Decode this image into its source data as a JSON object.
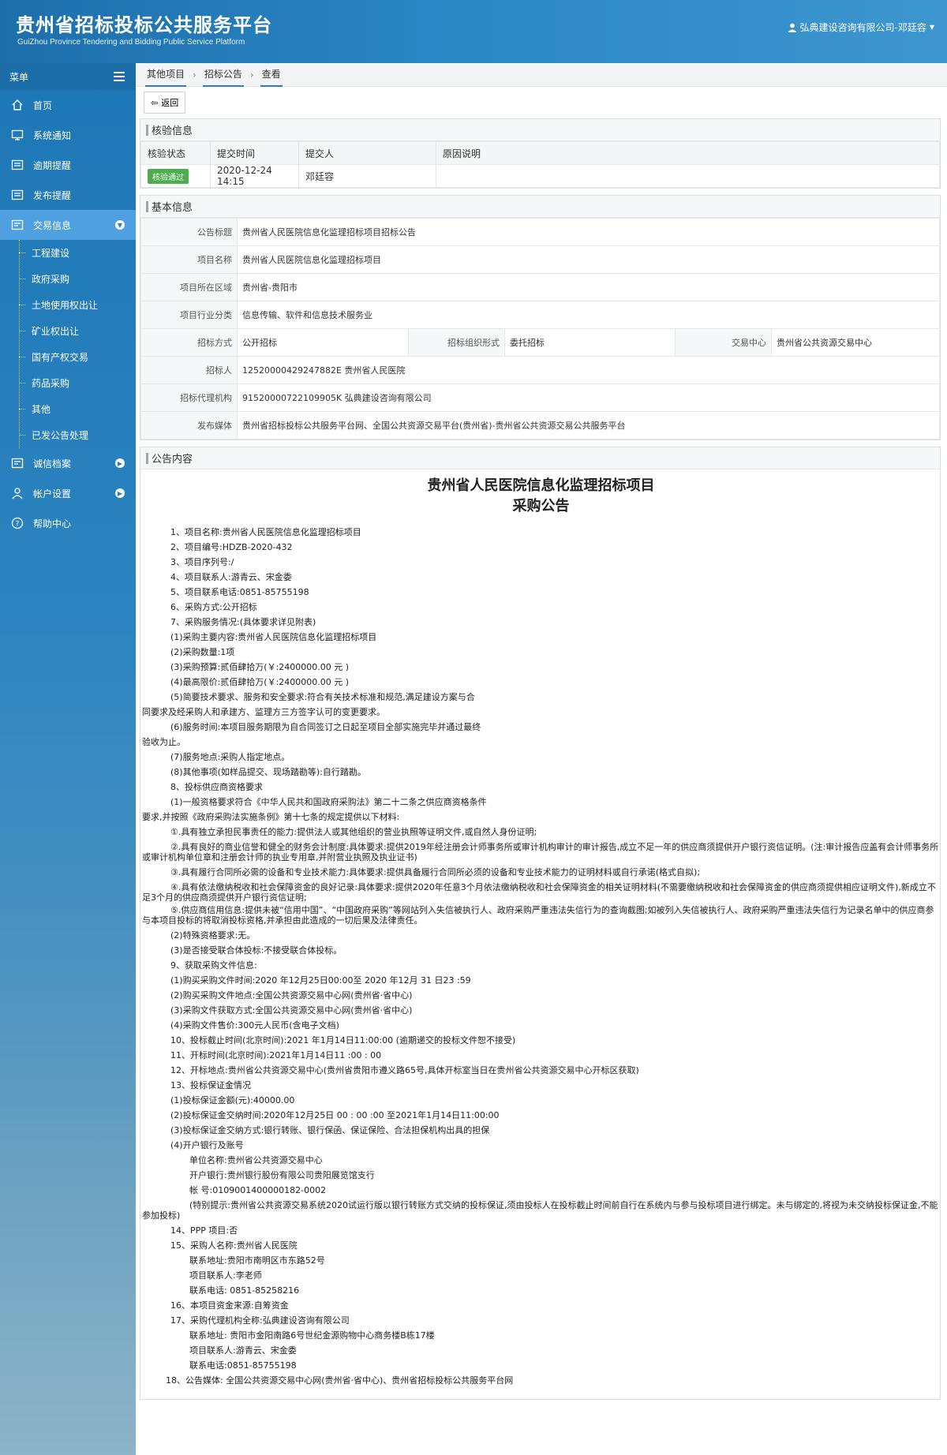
{
  "header": {
    "title": "贵州省招标投标公共服务平台",
    "subtitle": "GuiZhou Province Tendering and Bidding Public Service Platform",
    "user": "弘典建设咨询有限公司-邓廷容"
  },
  "sidebar": {
    "menu_label": "菜单",
    "items": [
      {
        "label": "首页",
        "icon": "home-icon"
      },
      {
        "label": "系统通知",
        "icon": "monitor-icon"
      },
      {
        "label": "逾期提醒",
        "icon": "inbox-icon"
      },
      {
        "label": "发布提醒",
        "icon": "inbox-icon"
      },
      {
        "label": "交易信息",
        "icon": "list-icon"
      },
      {
        "label": "诚信档案",
        "icon": "list-icon"
      },
      {
        "label": "帐户设置",
        "icon": "user-icon"
      },
      {
        "label": "帮助中心",
        "icon": "help-icon"
      }
    ],
    "sub_items": [
      "工程建设",
      "政府采购",
      "土地使用权出让",
      "矿业权出让",
      "国有产权交易",
      "药品采购",
      "其他",
      "已发公告处理"
    ]
  },
  "breadcrumb": [
    "其他项目",
    "招标公告",
    "查看"
  ],
  "toolbar": {
    "back": "返回"
  },
  "verify": {
    "title": "核验信息",
    "headers": [
      "核验状态",
      "提交时间",
      "提交人",
      "原因说明"
    ],
    "status": "核验通过",
    "time": "2020-12-24 14:15",
    "submitter": "邓廷容",
    "reason": ""
  },
  "basic": {
    "title": "基本信息",
    "labels": {
      "notice_title": "公告标题",
      "project_name": "项目名称",
      "region": "项目所在区域",
      "industry": "项目行业分类",
      "method": "招标方式",
      "org_form": "招标组织形式",
      "center": "交易中心",
      "tenderer": "招标人",
      "agency": "招标代理机构",
      "media": "发布媒体"
    },
    "values": {
      "notice_title": "贵州省人民医院信息化监理招标项目招标公告",
      "project_name": "贵州省人民医院信息化监理招标项目",
      "region": "贵州省-贵阳市",
      "industry": "信息传输、软件和信息技术服务业",
      "method": "公开招标",
      "org_form": "委托招标",
      "center": "贵州省公共资源交易中心",
      "tenderer": "12520000429247882E 贵州省人民医院",
      "agency": "91520000722109905K 弘典建设咨询有限公司",
      "media": "贵州省招标投标公共服务平台网、全国公共资源交易平台(贵州省)-贵州省公共资源交易公共服务平台"
    }
  },
  "notice": {
    "section_title": "公告内容",
    "heading1": "贵州省人民医院信息化监理招标项目",
    "heading2": "采购公告",
    "lines": [
      {
        "t": "1、项目名称:贵州省人民医院信息化监理招标项目",
        "i": 36
      },
      {
        "t": "2、项目编号:HDZB-2020-432",
        "i": 36
      },
      {
        "t": "3、项目序列号:/",
        "i": 36
      },
      {
        "t": "4、项目联系人:游青云、宋金委",
        "i": 36
      },
      {
        "t": "5、项目联系电话:0851-85755198",
        "i": 36
      },
      {
        "t": "6、采购方式:公开招标",
        "i": 36
      },
      {
        "t": "7、采购服务情况:(具体要求详见附表)",
        "i": 36
      },
      {
        "t": "(1)采购主要内容:贵州省人民医院信息化监理招标项目",
        "i": 36
      },
      {
        "t": "(2)采购数量:1项",
        "i": 36
      },
      {
        "t": "(3)采购预算:贰佰肆拾万(￥:2400000.00 元 )",
        "i": 36
      },
      {
        "t": "(4)最高限价:贰佰肆拾万(￥:2400000.00 元 )",
        "i": 36
      },
      {
        "t": "(5)简要技术要求、服务和安全要求:符合有关技术标准和规范,满足建设方案与合",
        "i": 36
      },
      {
        "t": "同要求及经采购人和承建方、监理方三方签字认可的变更要求。",
        "i": 0
      },
      {
        "t": "(6)服务时间:本项目服务期限为自合同签订之日起至项目全部实施完毕并通过最终",
        "i": 36
      },
      {
        "t": "验收为止。",
        "i": 0
      },
      {
        "t": "(7)服务地点:采购人指定地点。",
        "i": 36
      },
      {
        "t": "(8)其他事项(如样品提交、现场踏勘等):自行踏勘。",
        "i": 36
      },
      {
        "t": "8、投标供应商资格要求",
        "i": 36
      },
      {
        "t": "(1)一般资格要求符合《中华人民共和国政府采购法》第二十二条之供应商资格条件",
        "i": 36
      },
      {
        "t": "要求,并按照《政府采购法实施条例》第十七条的规定提供以下材料:",
        "i": 0
      },
      {
        "t": "①.具有独立承担民事责任的能力:提供法人或其他组织的营业执照等证明文件,或自然人身份证明;",
        "i": 36
      },
      {
        "t": "②.具有良好的商业信誉和健全的财务会计制度:具体要求:提供2019年经注册会计师事务所或审计机构审计的审计报告,成立不足一年的供应商须提供开户银行资信证明。(注:审计报告应盖有会计师事务所或审计机构单位章和注册会计师的执业专用章,并附营业执照及执业证书)",
        "i": 36,
        "w": 1
      },
      {
        "t": "③.具有履行合同所必需的设备和专业技术能力:具体要求:提供具备履行合同所必须的设备和专业技术能力的证明材料或自行承诺(格式自拟);",
        "i": 36
      },
      {
        "t": "④.具有依法缴纳税收和社会保障资金的良好记录:具体要求:提供2020年任意3个月依法缴纳税收和社会保障资金的相关证明材料(不需要缴纳税收和社会保障资金的供应商须提供相应证明文件),新成立不足3个月的供应商须提供开户银行资信证明;",
        "i": 36,
        "w": 1
      },
      {
        "t": "⑤.供应商信用信息:提供未被“信用中国”、“中国政府采购”等网站列入失信被执行人、政府采购严重违法失信行为的查询截图;如被列入失信被执行人、政府采购严重违法失信行为记录名单中的供应商参与本项目投标的将取消投标资格,并承担由此造成的一切后果及法律责任。",
        "i": 36,
        "w": 1
      },
      {
        "t": "(2)特殊资格要求:无。",
        "i": 36
      },
      {
        "t": "(3)是否接受联合体投标:不接受联合体投标。",
        "i": 36
      },
      {
        "t": "9、获取采购文件信息:",
        "i": 36
      },
      {
        "t": "(1)购买采购文件时间:2020 年12月25日00:00至 2020 年12月  31  日23  :59",
        "i": 36
      },
      {
        "t": "(2)购买采购文件地点:全国公共资源交易中心网(贵州省·省中心)",
        "i": 36
      },
      {
        "t": "(3)采购文件获取方式:全国公共资源交易中心网(贵州省·省中心)",
        "i": 36
      },
      {
        "t": "(4)采购文件售价:300元人民币(含电子文档)",
        "i": 36
      },
      {
        "t": "10、投标截止时间(北京时间):2021 年1月14日11:00:00     (逾期递交的投标文件恕不接受)",
        "i": 36
      },
      {
        "t": "11、开标时间(北京时间):2021年1月14日11  :00  :  00",
        "i": 36
      },
      {
        "t": "12、开标地点:贵州省公共资源交易中心(贵州省贵阳市遵义路65号,具体开标室当日在贵州省公共资源交易中心开标区获取)",
        "i": 36
      },
      {
        "t": "13、投标保证金情况",
        "i": 36
      },
      {
        "t": "(1)投标保证金额(元):40000.00",
        "i": 36
      },
      {
        "t": "(2)投标保证金交纳时间:2020年12月25日  00  :  00  :00       至2021年1月14日11:00:00",
        "i": 36
      },
      {
        "t": "(3)投标保证金交纳方式:银行转账、银行保函、保证保险、合法担保机构出具的担保",
        "i": 36
      },
      {
        "t": "(4)开户银行及账号",
        "i": 36
      },
      {
        "t": "单位名称:贵州省公共资源交易中心",
        "i": 60
      },
      {
        "t": "开户银行:贵州银行股份有限公司贵阳展览馆支行",
        "i": 60
      },
      {
        "t": "帐  号:0109001400000182-0002",
        "i": 60
      },
      {
        "t": "(特别提示:贵州省公共资源交易系统2020试运行版以银行转账方式交纳的投标保证,须由投标人在投标截止时间前自行在系统内与参与投标项目进行绑定。未与绑定的,将视为未交纳投标保证金,不能参加投标)",
        "i": 60,
        "w": 1
      },
      {
        "t": "14、PPP 项目:否",
        "i": 36
      },
      {
        "t": "15、采购人名称:贵州省人民医院",
        "i": 36
      },
      {
        "t": "联系地址:贵阳市南明区市东路52号",
        "i": 60
      },
      {
        "t": "项目联系人:李老师",
        "i": 60
      },
      {
        "t": "联系电话: 0851-85258216",
        "i": 60
      },
      {
        "t": "16、本项目资金来源:自筹资金",
        "i": 36
      },
      {
        "t": "17、采购代理机构全称:弘典建设咨询有限公司",
        "i": 36
      },
      {
        "t": "联系地址: 贵阳市金阳南路6号世纪金源购物中心商务楼B栋17楼",
        "i": 60
      },
      {
        "t": "项目联系人:游青云、宋金委",
        "i": 60
      },
      {
        "t": "联系电话:0851-85755198",
        "i": 60
      },
      {
        "t": "18、公告媒体: 全国公共资源交易中心网(贵州省·省中心)、贵州省招标投标公共服务平台网",
        "i": 30
      }
    ]
  }
}
